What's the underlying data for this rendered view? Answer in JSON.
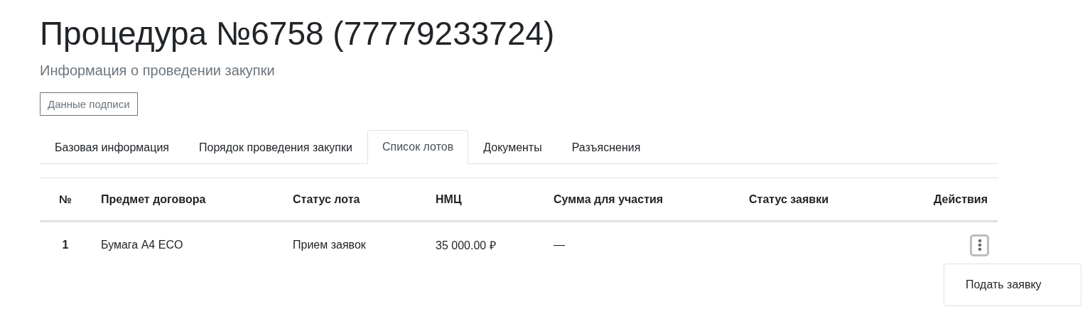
{
  "title": "Процедура №6758 (77779233724)",
  "subtitle": "Информация о проведении закупки",
  "signature_button": "Данные подписи",
  "tabs": [
    {
      "label": "Базовая информация",
      "selected": false
    },
    {
      "label": "Порядок проведения закупки",
      "selected": false
    },
    {
      "label": "Список лотов",
      "selected": true
    },
    {
      "label": "Документы",
      "selected": false
    },
    {
      "label": "Разъяснения",
      "selected": false
    }
  ],
  "table": {
    "columns": [
      "№",
      "Предмет договора",
      "Статус лота",
      "НМЦ",
      "Сумма для участия",
      "Статус заявки",
      "Действия"
    ],
    "rows": [
      {
        "number": "1",
        "subject": "Бумага А4 ECO",
        "lot_status": "Прием заявок",
        "price": "35 000.00 ₽",
        "participation_sum": "—",
        "menu_expanded": true,
        "menu_items": [
          "Подать заявку"
        ]
      }
    ]
  }
}
